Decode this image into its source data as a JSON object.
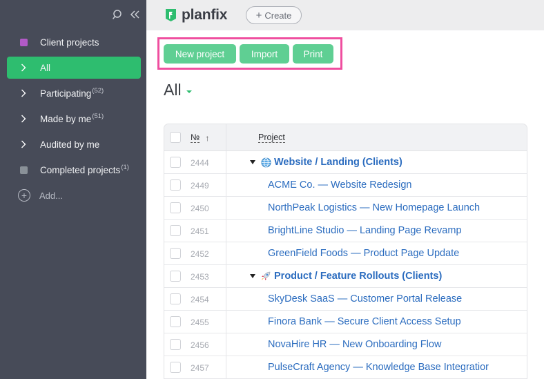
{
  "sidebar": {
    "items": [
      {
        "label": "Client projects",
        "count": "",
        "color": "#b25ac7",
        "kind": "square"
      },
      {
        "label": "All",
        "count": "",
        "kind": "chevron",
        "active": true
      },
      {
        "label": "Participating",
        "count": "(52)",
        "kind": "chevron"
      },
      {
        "label": "Made by me",
        "count": "(51)",
        "kind": "chevron"
      },
      {
        "label": "Audited by me",
        "count": "",
        "kind": "chevron"
      },
      {
        "label": "Completed projects",
        "count": "(1)",
        "color": "#8a9198",
        "kind": "square"
      }
    ],
    "add_label": "Add..."
  },
  "topbar": {
    "logo": "planfix",
    "create_label": "Create"
  },
  "actions": {
    "new_project": "New project",
    "import": "Import",
    "print": "Print"
  },
  "heading": "All",
  "table": {
    "col_number": "№",
    "col_project": "Project",
    "rows": [
      {
        "number": "2444",
        "title": "Website / Landing (Clients)",
        "group": true,
        "icon": "globe-icon"
      },
      {
        "number": "2449",
        "title": "ACME Co. — Website Redesign"
      },
      {
        "number": "2450",
        "title": "NorthPeak Logistics — New Homepage Launch"
      },
      {
        "number": "2451",
        "title": "BrightLine Studio — Landing Page Revamp"
      },
      {
        "number": "2452",
        "title": "GreenField Foods — Product Page Update"
      },
      {
        "number": "2453",
        "title": "Product / Feature Rollouts (Clients)",
        "group": true,
        "icon": "rocket-icon"
      },
      {
        "number": "2454",
        "title": "SkyDesk SaaS — Customer Portal Release"
      },
      {
        "number": "2455",
        "title": "Finora Bank — Secure Client Access Setup"
      },
      {
        "number": "2456",
        "title": "NovaHire HR — New Onboarding Flow"
      },
      {
        "number": "2457",
        "title": "PulseCraft Agency — Knowledge Base Integratior"
      }
    ]
  }
}
